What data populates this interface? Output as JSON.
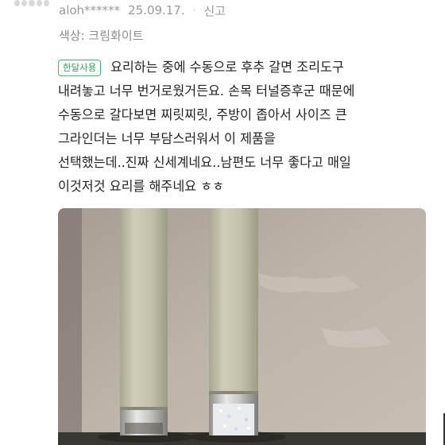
{
  "review": {
    "rating_icon": "star-rating-icon",
    "author": "aloh******",
    "date": "25.09.17.",
    "separator": "·",
    "report_label": "신고",
    "option_text": "색상: 크림화이트",
    "badge": "한달사용",
    "text_lines": [
      "요리하는 중에 수동으로 후추 갈면 조리도구",
      "내려놓고 너무 번거로웠거든요. 손목 터널증후군 때문에",
      "수동으로 갈다보면 찌릿찌릿, 주방이 좁아서 사이즈 큰",
      "그라인더는 너무 부담스러워서 이 제품을",
      "선택했는데..진짜 신세계네요..남편도 너무 좋다고 매일",
      "이것저것 요리를 해주네요 ㅎㅎ"
    ]
  },
  "photo": {
    "subject": "two cream-colored electric pepper grinders",
    "colors": {
      "wall": "#b8aea4",
      "grinder_body": "#c6c3ad",
      "salt": "#e8eaec"
    }
  },
  "colors": {
    "badge_green": "#3cb371",
    "meta_gray": "#9a9a9a"
  }
}
